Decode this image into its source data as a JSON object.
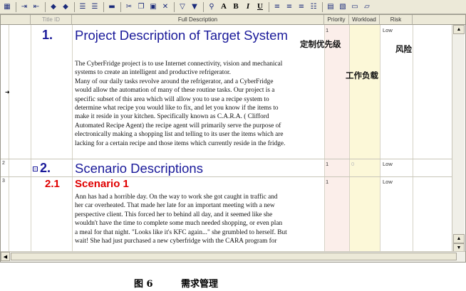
{
  "toolbar": {
    "icons": [
      "table-icon",
      "indent-icon",
      "outdent-icon",
      "arrow-left-icon",
      "arrow-right-icon",
      "align-top-icon",
      "align-bottom-icon",
      "line-icon",
      "cut-icon",
      "copy-icon",
      "paste-icon",
      "delete-icon",
      "filter-icon",
      "filter-edit-icon",
      "find-icon",
      "font-icon",
      "bold-icon",
      "italic-icon",
      "underline-icon",
      "align-left-icon",
      "align-center-icon",
      "align-right-icon",
      "list-icon",
      "doc-icon",
      "doc-edit-icon",
      "folder-icon",
      "folder-open-icon"
    ],
    "font_letter": "A",
    "bold_letter": "B",
    "italic_letter": "I",
    "underline_letter": "U"
  },
  "columns": {
    "title_id": "Title ID",
    "full_description": "Full Description",
    "priority": "Priority",
    "workload": "Workload",
    "risk": "Risk"
  },
  "rows": [
    {
      "num": "",
      "heading_num": "1.",
      "heading": "Project Description of Target System",
      "body": "The CyberFridge project is to use Internet connectivity, vision and mechanical\nsystems to create an intelligent and productive refrigerator.\nMany of our daily tasks revolve around the refrigerator, and a CyberFridge\nwould allow the automation of many of these routine tasks.  Our project is a\nspecific subset of this area which will allow you to use a recipe system to\ndetermine what recipe you would like to fix, and let you know if the items to\nmake it reside in your kitchen. Specifically known as C.A.R.A. ( Clifford\nAutomated Recipe Agent) the recipe agent will primarily serve the purpose of\nelectronically making a shopping list and telling to its user the items which are\nlacking for a certain recipe and those items which currently reside in the fridge.",
      "priority": "1",
      "workload": "",
      "risk": "Low",
      "selector": "➜"
    },
    {
      "num": "2",
      "heading_num": "2.",
      "heading": "Scenario Descriptions",
      "priority": "1",
      "workload": "0",
      "risk": "Low"
    },
    {
      "num": "3",
      "heading_num": "2.1",
      "heading": "Scenario 1",
      "body": "Ann has had a horrible day. On the way to work she got caught in traffic and\nher car overheated. That made her late for an important meeting with a new\nperspective client. This forced her to behind all day, and it seemed like she\nwouldn't have the time to complete some much needed shopping, or even plan\na meal for that night. \"Looks like it's KFC again...\" she grumbled to herself. But\nwait! She had just purchased a new cyberfridge with the CARA program for",
      "priority": "1",
      "workload": "",
      "risk": "Low"
    }
  ],
  "annotations": {
    "priority": "定制优先级",
    "risk": "风险",
    "workload": "工作负载"
  },
  "expand_symbol": "−",
  "caption": {
    "figure": "图 6",
    "title": "需求管理"
  },
  "colors": {
    "priority_bg": "#fbeeea",
    "workload_bg": "#fcf8d8",
    "heading_blue": "#1a1a9a",
    "heading_red": "#e00000"
  }
}
